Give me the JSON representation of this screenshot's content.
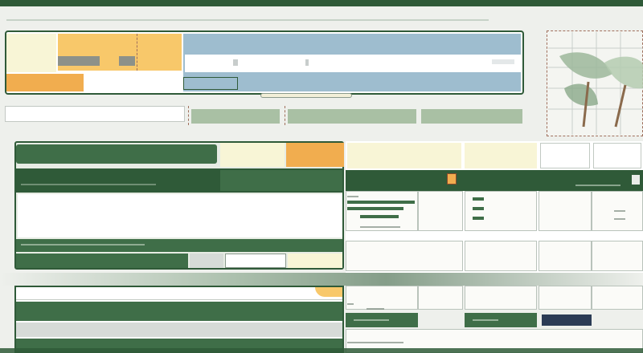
{
  "header": {
    "title": "",
    "accent": "#3f6e48"
  },
  "top_panel": {
    "left_label": "",
    "left_field": "",
    "left_button": "",
    "blue_title": "",
    "blue_field": "",
    "highlight_label": "",
    "small_button": ""
  },
  "filter_row": {
    "label": "",
    "tabs": [
      "",
      "",
      ""
    ]
  },
  "left_panel": {
    "tab_label": "",
    "header_title": "",
    "header_right": "",
    "note_label": "",
    "note_sub": "",
    "section_label": "",
    "section_sub": "",
    "button_label": ""
  },
  "grid": {
    "header_cells": [
      "",
      "",
      "",
      ""
    ],
    "toolbar_label": "",
    "rows": [
      {
        "label": "",
        "value": ""
      },
      {
        "label": "",
        "value": ""
      },
      {
        "label": "",
        "value": ""
      },
      {
        "label": "",
        "value": ""
      }
    ],
    "right_col_values": [
      "",
      "",
      "",
      ""
    ]
  },
  "bottom_panel": {
    "title": "",
    "status": "",
    "row_labels": [
      "",
      "",
      ""
    ]
  },
  "colors": {
    "primary_green": "#3f6e48",
    "dark_green": "#2f5a38",
    "light_green": "#a9c0a4",
    "orange": "#f1ad4f",
    "yellow": "#f8c86a",
    "blue": "#9ebdcf",
    "cream": "#f8f5d6"
  },
  "icons": [
    "leaf-plant-icon",
    "dropdown-icon",
    "close-icon"
  ]
}
